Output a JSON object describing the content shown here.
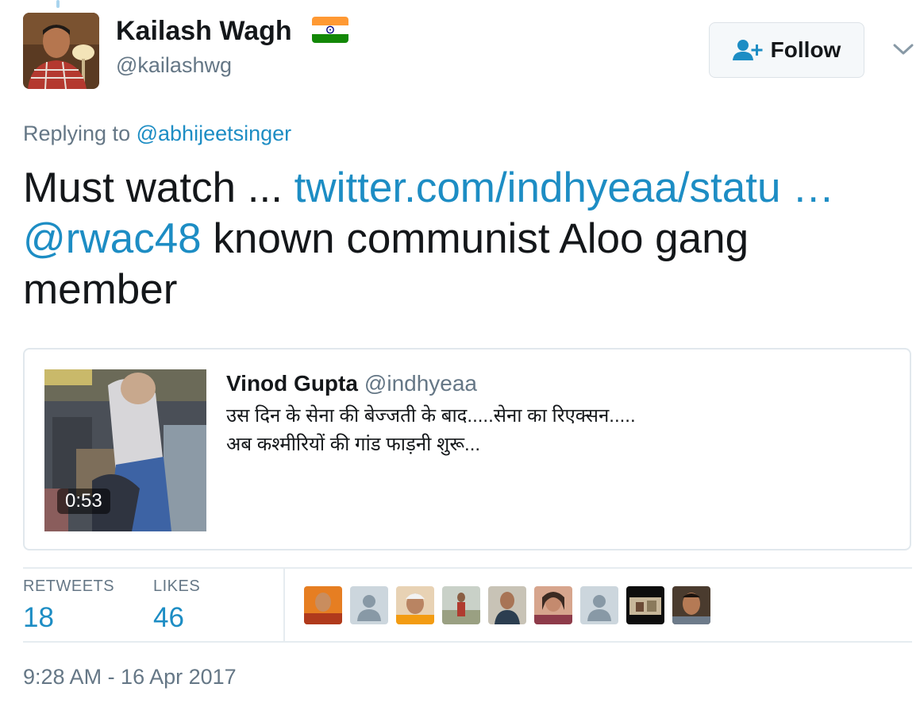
{
  "user": {
    "display_name": "Kailash Wagh",
    "handle": "@kailashwg",
    "flag_icon": "india-flag-icon"
  },
  "follow_button": {
    "label": "Follow",
    "icon": "add-user-icon"
  },
  "menu_caret_icon": "chevron-down-icon",
  "reply": {
    "prefix": "Replying to",
    "mention": "@abhijeetsinger"
  },
  "tweet": {
    "text_start": "Must watch ...",
    "link": "twitter.com/indhyeaa/statu …",
    "mention": "@rwac48",
    "text_end": "known communist Aloo gang member"
  },
  "quoted_tweet": {
    "name": "Vinod Gupta",
    "handle": "@indhyeaa",
    "text": "उस दिन के सेना की बेज्जती के बाद.....सेना का रिएक्सन.....\nअब कश्मीरियों की गांड फाड़नी शुरू...",
    "video_duration": "0:53"
  },
  "stats": {
    "retweets_label": "RETWEETS",
    "retweets": "18",
    "likes_label": "LIKES",
    "likes": "46"
  },
  "timestamp": "9:28 AM - 16 Apr 2017",
  "colors": {
    "link": "#1d8dc4",
    "secondary_text": "#657786",
    "border": "#e1e8ed"
  }
}
